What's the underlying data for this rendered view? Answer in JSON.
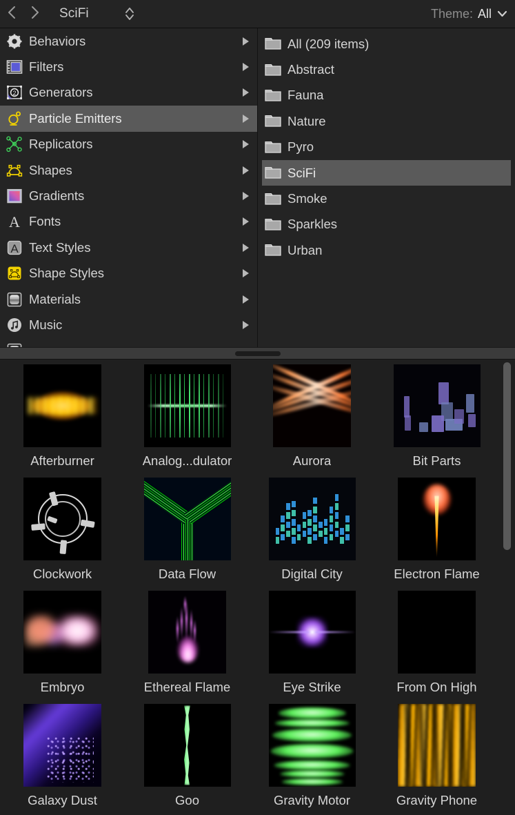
{
  "header": {
    "back_icon": "chevron-left-icon",
    "forward_icon": "chevron-right-icon",
    "title": "SciFi",
    "stepper_icon": "up-down-stepper-icon",
    "theme_label": "Theme:",
    "theme_value": "All",
    "theme_chevron_icon": "chevron-down-icon"
  },
  "categories": [
    {
      "label": "Behaviors",
      "icon": "gear-icon",
      "selected": false
    },
    {
      "label": "Filters",
      "icon": "filmstrip-icon",
      "selected": false
    },
    {
      "label": "Generators",
      "icon": "generator-icon",
      "selected": false
    },
    {
      "label": "Particle Emitters",
      "icon": "emitter-icon",
      "selected": true
    },
    {
      "label": "Replicators",
      "icon": "replicator-icon",
      "selected": false
    },
    {
      "label": "Shapes",
      "icon": "shape-bezier-icon",
      "selected": false
    },
    {
      "label": "Gradients",
      "icon": "gradient-swatch-icon",
      "selected": false
    },
    {
      "label": "Fonts",
      "icon": "letter-a-icon",
      "selected": false
    },
    {
      "label": "Text Styles",
      "icon": "text-style-icon",
      "selected": false
    },
    {
      "label": "Shape Styles",
      "icon": "shape-style-icon",
      "selected": false
    },
    {
      "label": "Materials",
      "icon": "material-icon",
      "selected": false
    },
    {
      "label": "Music",
      "icon": "music-note-icon",
      "selected": false
    }
  ],
  "folders": [
    {
      "label": "All (209 items)",
      "selected": false
    },
    {
      "label": "Abstract",
      "selected": false
    },
    {
      "label": "Fauna",
      "selected": false
    },
    {
      "label": "Nature",
      "selected": false
    },
    {
      "label": "Pyro",
      "selected": false
    },
    {
      "label": "SciFi",
      "selected": true
    },
    {
      "label": "Smoke",
      "selected": false
    },
    {
      "label": "Sparkles",
      "selected": false
    },
    {
      "label": "Urban",
      "selected": false
    }
  ],
  "grid": {
    "items": [
      {
        "label": "Afterburner",
        "art": "art-afterburner",
        "size": "std"
      },
      {
        "label": "Analog...dulator",
        "art": "art-wave",
        "size": "wide"
      },
      {
        "label": "Aurora",
        "art": "art-aurora",
        "size": "std"
      },
      {
        "label": "Bit Parts",
        "art": "art-bits",
        "size": "wide"
      },
      {
        "label": "Clockwork",
        "art": "art-clock",
        "size": "std"
      },
      {
        "label": "Data Flow",
        "art": "art-dataflow",
        "size": "wide"
      },
      {
        "label": "Digital City",
        "art": "art-city",
        "size": "wide"
      },
      {
        "label": "Electron Flame",
        "art": "art-electron",
        "size": "std"
      },
      {
        "label": "Embryo",
        "art": "art-embryo",
        "size": "std"
      },
      {
        "label": "Ethereal Flame",
        "art": "art-ethereal",
        "size": "std"
      },
      {
        "label": "Eye Strike",
        "art": "art-eye",
        "size": "wide"
      },
      {
        "label": "From On High",
        "art": "art-fromonhigh",
        "size": "std"
      },
      {
        "label": "Galaxy Dust",
        "art": "art-galaxy",
        "size": "std"
      },
      {
        "label": "Goo",
        "art": "art-goo",
        "size": "wide"
      },
      {
        "label": "Gravity Motor",
        "art": "art-gravity",
        "size": "wide"
      },
      {
        "label": "Gravity Phone",
        "art": "art-phone",
        "size": "std"
      }
    ]
  },
  "colors": {
    "window_bg": "#242424",
    "grid_bg": "#1f1f1f",
    "selection": "#5a5a5a",
    "text": "#d4d4d4",
    "splitter": "#3b3b3b",
    "scrollbar_thumb": "#5a5a5a",
    "accent_yellow": "#f2d200",
    "accent_green": "#3fd15a"
  }
}
